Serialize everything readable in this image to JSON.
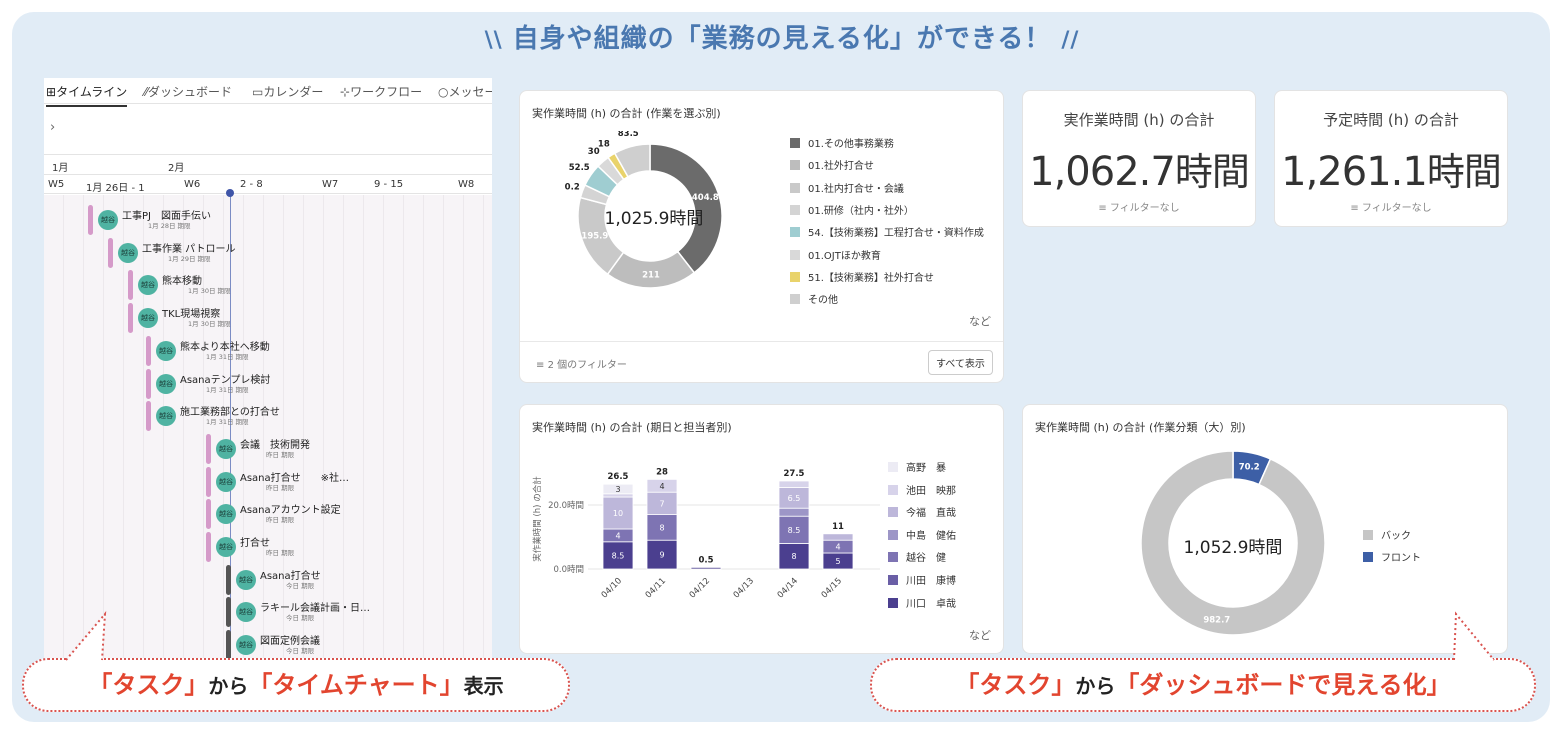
{
  "header": {
    "title": "自身や組織の「業務の見える化」ができる！",
    "slash_left": "\\\\",
    "slash_right": "//"
  },
  "timeline": {
    "tabs": [
      {
        "label": "タイムライン",
        "icon": "timeline-icon"
      },
      {
        "label": "ダッシュボード",
        "icon": "dashboard-icon"
      },
      {
        "label": "カレンダー",
        "icon": "calendar-icon"
      },
      {
        "label": "ワークフロー",
        "icon": "workflow-icon"
      },
      {
        "label": "メッセー",
        "icon": "message-icon"
      }
    ],
    "tab_icons": [
      "⊞",
      "⁄⁄",
      "▭",
      "⊹",
      "○"
    ],
    "expand_chevron": "›",
    "months": [
      "1月",
      "2月"
    ],
    "weeks": [
      "W5",
      "1月 26日 - 1",
      "W6",
      "2 - 8",
      "W7",
      "9 - 15",
      "W8"
    ],
    "tasks": [
      {
        "name": "工事PJ　図面手伝い",
        "date": "1月 28日 期限",
        "avatar": "越谷",
        "color": "pink"
      },
      {
        "name": "工事作業 パトロール",
        "date": "1月 29日 期限",
        "avatar": "越谷",
        "color": "pink"
      },
      {
        "name": "熊本移動",
        "date": "1月 30日 期限",
        "avatar": "越谷",
        "color": "pink"
      },
      {
        "name": "TKL現場視察",
        "date": "1月 30日 期限",
        "avatar": "越谷",
        "color": "pink"
      },
      {
        "name": "熊本より本社へ移動",
        "date": "1月 31日 期限",
        "avatar": "越谷",
        "color": "pink"
      },
      {
        "name": "Asanaテンプレ検討",
        "date": "1月 31日 期限",
        "avatar": "越谷",
        "color": "pink"
      },
      {
        "name": "施工業務部との打合せ",
        "date": "1月 31日 期限",
        "avatar": "越谷",
        "color": "pink"
      },
      {
        "name": "会議　技術開発",
        "date": "昨日 期限",
        "avatar": "越谷",
        "color": "pink"
      },
      {
        "name": "Asana打合せ　　※社…",
        "date": "昨日 期限",
        "avatar": "越谷",
        "color": "pink"
      },
      {
        "name": "Asanaアカウント設定",
        "date": "昨日 期限",
        "avatar": "越谷",
        "color": "pink"
      },
      {
        "name": "打合せ",
        "date": "昨日 期限",
        "avatar": "越谷",
        "color": "pink"
      },
      {
        "name": "Asana打合せ",
        "date": "今日 期限",
        "avatar": "越谷",
        "color": "dark"
      },
      {
        "name": "ラキール会議計画・日…",
        "date": "今日 期限",
        "avatar": "越谷",
        "color": "dark"
      },
      {
        "name": "図面定例会議",
        "date": "今日 期限",
        "avatar": "越谷",
        "color": "dark"
      }
    ]
  },
  "donut_card": {
    "title": "実作業時間 (h) の合計 (作業を選ぶ別)",
    "center": "1,025.9時間",
    "more": "など",
    "filter": "2 個のフィルター",
    "filter_icon": "filter-icon",
    "show_all": "すべて表示",
    "legend": [
      {
        "label": "01.その他事務業務",
        "color": "#6b6b6b"
      },
      {
        "label": "01.社外打合せ",
        "color": "#bdbdbd"
      },
      {
        "label": "01.社内打合せ・会議",
        "color": "#c9c9c9"
      },
      {
        "label": "01.研修（社内・社外）",
        "color": "#d4d4d4"
      },
      {
        "label": "54.【技術業務】工程打合せ・資料作成",
        "color": "#9fcdd1"
      },
      {
        "label": "01.OJTほか教育",
        "color": "#d9d9d9"
      },
      {
        "label": "51.【技術業務】社外打合せ",
        "color": "#e9d36b"
      },
      {
        "label": "その他",
        "color": "#cfcfcf"
      }
    ]
  },
  "kpi1": {
    "title": "実作業時間 (h) の合計",
    "value": "1,062.7",
    "unit": "時間",
    "filter": "フィルターなし"
  },
  "kpi2": {
    "title": "予定時間 (h) の合計",
    "value": "1,261.1",
    "unit": "時間",
    "filter": "フィルターなし"
  },
  "bar_card": {
    "title": "実作業時間 (h) の合計 (期日と担当者別)",
    "more": "など"
  },
  "ring_card": {
    "title": "実作業時間 (h) の合計 (作業分類（大）別)",
    "center": "1,052.9時間"
  },
  "callouts": {
    "left_parts": [
      "「タスク」",
      "から",
      "「タイムチャート」",
      "表示"
    ],
    "right_parts": [
      "「タスク」",
      "から",
      "「ダッシュボードで見える化」"
    ]
  },
  "chart_data": [
    {
      "type": "pie",
      "variant": "donut",
      "title": "実作業時間 (h) の合計 (作業を選ぶ別)",
      "slices": [
        {
          "label": "01.その他事務業務",
          "value": 404.8,
          "color": "#6b6b6b"
        },
        {
          "label": "01.社外打合せ",
          "value": 211,
          "color": "#bdbdbd"
        },
        {
          "label": "01.社内打合せ・会議",
          "value": 195.9,
          "color": "#c9c9c9"
        },
        {
          "label": "01.研修（社内・社外）",
          "value": 30.2,
          "color": "#d4d4d4"
        },
        {
          "label": "54.【技術業務】工程打合せ・資料作成",
          "value": 52.5,
          "color": "#9fcdd1"
        },
        {
          "label": "01.OJTほか教育",
          "value": 30,
          "color": "#d9d9d9"
        },
        {
          "label": "51.【技術業務】社外打合せ",
          "value": 18,
          "color": "#e9d36b"
        },
        {
          "label": "その他",
          "value": 83.5,
          "color": "#cfcfcf"
        }
      ]
    },
    {
      "type": "bar",
      "stacked": true,
      "title": "実作業時間 (h) の合計 (期日と担当者別)",
      "ylabel": "実作業時間 (h) の合計",
      "yticks": [
        "0.0時間",
        "20.0時間"
      ],
      "ylim": [
        0,
        30
      ],
      "categories": [
        "04/10",
        "04/11",
        "04/12",
        "04/13",
        "04/14",
        "04/15"
      ],
      "totals": [
        "26.5",
        "28",
        "0.5",
        "",
        "27.5",
        "11"
      ],
      "series": [
        {
          "name": "川口　卓哉",
          "color": "#4b3f8f",
          "values": [
            8.5,
            9,
            0.5,
            0,
            8,
            5
          ]
        },
        {
          "name": "川田　康博",
          "color": "#6a5fa6",
          "values": [
            0,
            0,
            0,
            0,
            0,
            0
          ]
        },
        {
          "name": "越谷　健",
          "color": "#7e74b3",
          "values": [
            4,
            8,
            0,
            0,
            8.5,
            4
          ]
        },
        {
          "name": "中島　健佑",
          "color": "#9d96c7",
          "values": [
            0,
            0,
            0,
            0,
            2.5,
            0
          ]
        },
        {
          "name": "今福　直哉",
          "color": "#bdb7da",
          "values": [
            10,
            7,
            0,
            0,
            6.5,
            2
          ]
        },
        {
          "name": "池田　映那",
          "color": "#d7d3ea",
          "values": [
            1,
            4,
            0,
            0,
            2,
            0
          ]
        },
        {
          "name": "高野　暴",
          "color": "#ecebf4",
          "values": [
            3,
            0,
            0,
            0,
            0,
            0
          ]
        }
      ]
    },
    {
      "type": "pie",
      "variant": "donut",
      "title": "実作業時間 (h) の合計 (作業分類（大）別)",
      "slices": [
        {
          "label": "バック",
          "value": 982.7,
          "color": "#c6c6c6"
        },
        {
          "label": "フロント",
          "value": 70.2,
          "color": "#3d5fa6"
        }
      ]
    }
  ]
}
